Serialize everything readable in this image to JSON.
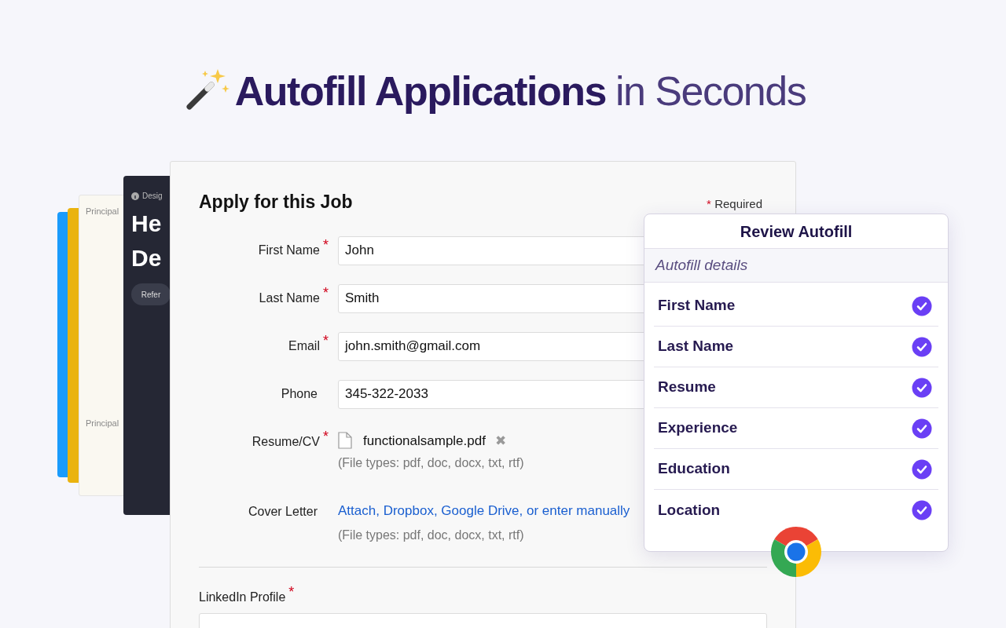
{
  "headline": {
    "strong": "Autofill Applications",
    "rest": "in Seconds"
  },
  "color_cards": [
    {
      "color": "#1a9bfc"
    },
    {
      "color": "#eab30f"
    }
  ],
  "listing_card": {
    "sections": [
      {
        "title": "Principal"
      },
      {
        "title": "Principal"
      }
    ]
  },
  "dark_card": {
    "tag": "Desig",
    "title_lines": [
      "He",
      "De"
    ],
    "button": "Refer"
  },
  "form": {
    "title": "Apply for this Job",
    "required_mark": "*",
    "required_note": "Required",
    "fields": [
      {
        "kind": "input",
        "label": "First Name",
        "required": true,
        "value": "John"
      },
      {
        "kind": "input",
        "label": "Last Name",
        "required": true,
        "value": "Smith"
      },
      {
        "kind": "input",
        "label": "Email",
        "required": true,
        "value": "john.smith@gmail.com"
      },
      {
        "kind": "input",
        "label": "Phone",
        "required": false,
        "value": "345-322-2033"
      },
      {
        "kind": "file",
        "label": "Resume/CV",
        "required": true,
        "value": "functionalsample.pdf",
        "remove": "✖",
        "hint": "(File types: pdf, doc, docx, txt, rtf)"
      },
      {
        "kind": "link",
        "label": "Cover Letter",
        "required": false,
        "value": "Attach, Dropbox, Google Drive, or enter manually",
        "hint": "(File types: pdf, doc, docx, txt, rtf)"
      }
    ],
    "bottom_fields": [
      {
        "label": "LinkedIn Profile",
        "required": true
      }
    ]
  },
  "panel": {
    "title": "Review Autofill",
    "section": "Autofill details",
    "items": [
      {
        "label": "First Name",
        "checked": true
      },
      {
        "label": "Last Name",
        "checked": true
      },
      {
        "label": "Resume",
        "checked": true
      },
      {
        "label": "Experience",
        "checked": true
      },
      {
        "label": "Education",
        "checked": true
      },
      {
        "label": "Location",
        "checked": true
      }
    ]
  }
}
